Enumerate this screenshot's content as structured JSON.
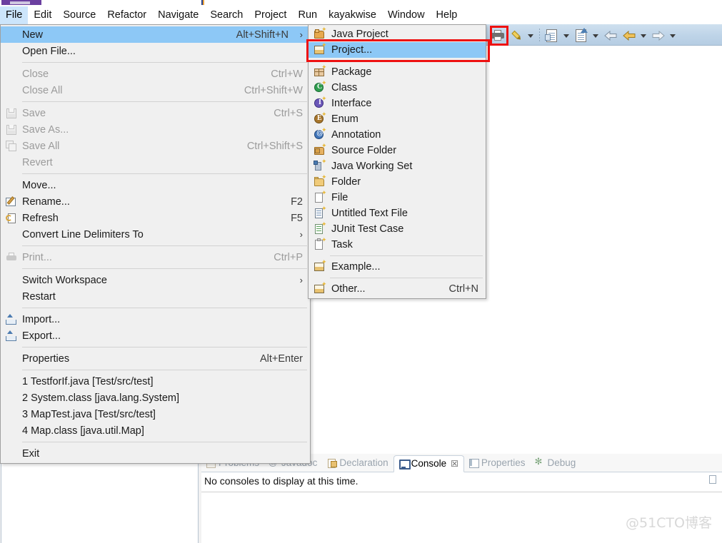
{
  "app": {
    "menubar": [
      {
        "label": "File",
        "active": true
      },
      {
        "label": "Edit",
        "active": false
      },
      {
        "label": "Source",
        "active": false
      },
      {
        "label": "Refactor",
        "active": false
      },
      {
        "label": "Navigate",
        "active": false
      },
      {
        "label": "Search",
        "active": false
      },
      {
        "label": "Project",
        "active": false
      },
      {
        "label": "Run",
        "active": false
      },
      {
        "label": "kayakwise",
        "active": false
      },
      {
        "label": "Window",
        "active": false
      },
      {
        "label": "Help",
        "active": false
      }
    ]
  },
  "toolbar": {
    "items": [
      {
        "name": "print-toolbar-icon"
      },
      {
        "name": "pencil-toolbar-icon"
      },
      {
        "name": "chevron-down-icon"
      },
      {
        "name": "separator"
      },
      {
        "name": "document-export-icon"
      },
      {
        "name": "chevron-down-icon"
      },
      {
        "name": "document-import-icon"
      },
      {
        "name": "chevron-down-icon"
      },
      {
        "name": "back-arrow-icon"
      },
      {
        "name": "back-arrow-yellow-icon"
      },
      {
        "name": "chevron-down-icon"
      },
      {
        "name": "forward-arrow-icon"
      },
      {
        "name": "chevron-down-icon"
      }
    ]
  },
  "file_menu": {
    "groups": [
      {
        "items": [
          {
            "label": "New",
            "accel": "Alt+Shift+N",
            "submenu": true,
            "highlight": true,
            "disabled": false,
            "icon": ""
          },
          {
            "label": "Open File...",
            "accel": "",
            "submenu": false,
            "highlight": false,
            "disabled": false,
            "icon": ""
          }
        ]
      },
      {
        "items": [
          {
            "label": "Close",
            "accel": "Ctrl+W",
            "submenu": false,
            "highlight": false,
            "disabled": true,
            "icon": ""
          },
          {
            "label": "Close All",
            "accel": "Ctrl+Shift+W",
            "submenu": false,
            "highlight": false,
            "disabled": true,
            "icon": ""
          }
        ]
      },
      {
        "items": [
          {
            "label": "Save",
            "accel": "Ctrl+S",
            "submenu": false,
            "highlight": false,
            "disabled": true,
            "icon": "save-icon"
          },
          {
            "label": "Save As...",
            "accel": "",
            "submenu": false,
            "highlight": false,
            "disabled": true,
            "icon": "save-as-icon"
          },
          {
            "label": "Save All",
            "accel": "Ctrl+Shift+S",
            "submenu": false,
            "highlight": false,
            "disabled": true,
            "icon": "save-all-icon"
          },
          {
            "label": "Revert",
            "accel": "",
            "submenu": false,
            "highlight": false,
            "disabled": true,
            "icon": ""
          }
        ]
      },
      {
        "items": [
          {
            "label": "Move...",
            "accel": "",
            "submenu": false,
            "highlight": false,
            "disabled": false,
            "icon": ""
          },
          {
            "label": "Rename...",
            "accel": "F2",
            "submenu": false,
            "highlight": false,
            "disabled": false,
            "icon": "rename-icon"
          },
          {
            "label": "Refresh",
            "accel": "F5",
            "submenu": false,
            "highlight": false,
            "disabled": false,
            "icon": "refresh-icon"
          },
          {
            "label": "Convert Line Delimiters To",
            "accel": "",
            "submenu": true,
            "highlight": false,
            "disabled": false,
            "icon": ""
          }
        ]
      },
      {
        "items": [
          {
            "label": "Print...",
            "accel": "Ctrl+P",
            "submenu": false,
            "highlight": false,
            "disabled": true,
            "icon": "print-icon"
          }
        ]
      },
      {
        "items": [
          {
            "label": "Switch Workspace",
            "accel": "",
            "submenu": true,
            "highlight": false,
            "disabled": false,
            "icon": ""
          },
          {
            "label": "Restart",
            "accel": "",
            "submenu": false,
            "highlight": false,
            "disabled": false,
            "icon": ""
          }
        ]
      },
      {
        "items": [
          {
            "label": "Import...",
            "accel": "",
            "submenu": false,
            "highlight": false,
            "disabled": false,
            "icon": "import-icon"
          },
          {
            "label": "Export...",
            "accel": "",
            "submenu": false,
            "highlight": false,
            "disabled": false,
            "icon": "export-icon"
          }
        ]
      },
      {
        "items": [
          {
            "label": "Properties",
            "accel": "Alt+Enter",
            "submenu": false,
            "highlight": false,
            "disabled": false,
            "icon": ""
          }
        ]
      },
      {
        "items": [
          {
            "label": "1 TestforIf.java  [Test/src/test]",
            "accel": "",
            "submenu": false,
            "highlight": false,
            "disabled": false,
            "icon": ""
          },
          {
            "label": "2 System.class  [java.lang.System]",
            "accel": "",
            "submenu": false,
            "highlight": false,
            "disabled": false,
            "icon": ""
          },
          {
            "label": "3 MapTest.java  [Test/src/test]",
            "accel": "",
            "submenu": false,
            "highlight": false,
            "disabled": false,
            "icon": ""
          },
          {
            "label": "4 Map.class  [java.util.Map]",
            "accel": "",
            "submenu": false,
            "highlight": false,
            "disabled": false,
            "icon": ""
          }
        ]
      },
      {
        "items": [
          {
            "label": "Exit",
            "accel": "",
            "submenu": false,
            "highlight": false,
            "disabled": false,
            "icon": ""
          }
        ]
      }
    ]
  },
  "new_submenu": {
    "groups": [
      {
        "items": [
          {
            "label": "Java Project",
            "accel": "",
            "highlight": false,
            "icon": "java-project-icon"
          },
          {
            "label": "Project...",
            "accel": "",
            "highlight": true,
            "icon": "project-icon"
          }
        ]
      },
      {
        "items": [
          {
            "label": "Package",
            "accel": "",
            "highlight": false,
            "icon": "package-icon"
          },
          {
            "label": "Class",
            "accel": "",
            "highlight": false,
            "icon": "class-icon"
          },
          {
            "label": "Interface",
            "accel": "",
            "highlight": false,
            "icon": "interface-icon"
          },
          {
            "label": "Enum",
            "accel": "",
            "highlight": false,
            "icon": "enum-icon"
          },
          {
            "label": "Annotation",
            "accel": "",
            "highlight": false,
            "icon": "annotation-icon"
          },
          {
            "label": "Source Folder",
            "accel": "",
            "highlight": false,
            "icon": "source-folder-icon"
          },
          {
            "label": "Java Working Set",
            "accel": "",
            "highlight": false,
            "icon": "java-working-set-icon"
          },
          {
            "label": "Folder",
            "accel": "",
            "highlight": false,
            "icon": "folder-icon"
          },
          {
            "label": "File",
            "accel": "",
            "highlight": false,
            "icon": "file-icon"
          },
          {
            "label": "Untitled Text File",
            "accel": "",
            "highlight": false,
            "icon": "untitled-text-file-icon"
          },
          {
            "label": "JUnit Test Case",
            "accel": "",
            "highlight": false,
            "icon": "junit-test-case-icon"
          },
          {
            "label": "Task",
            "accel": "",
            "highlight": false,
            "icon": "task-icon"
          }
        ]
      },
      {
        "items": [
          {
            "label": "Example...",
            "accel": "",
            "highlight": false,
            "icon": "example-icon"
          }
        ]
      },
      {
        "items": [
          {
            "label": "Other...",
            "accel": "Ctrl+N",
            "highlight": false,
            "icon": "other-icon"
          }
        ]
      }
    ]
  },
  "console_panel": {
    "tabs": [
      {
        "label": "Problems",
        "icon": "problems-icon",
        "active": false,
        "closable": false
      },
      {
        "label": "Javadoc",
        "icon": "javadoc-icon",
        "active": false,
        "closable": false
      },
      {
        "label": "Declaration",
        "icon": "declaration-icon",
        "active": false,
        "closable": false
      },
      {
        "label": "Console",
        "icon": "console-icon",
        "active": true,
        "closable": true
      },
      {
        "label": "Properties",
        "icon": "properties-icon",
        "active": false,
        "closable": false
      },
      {
        "label": "Debug",
        "icon": "debug-icon",
        "active": false,
        "closable": false
      }
    ],
    "close_glyph": "☒",
    "message": "No consoles to display at this time."
  },
  "annotations": {
    "watermark": "@51CTO博客",
    "highlight_color": "#ee1111"
  },
  "colors": {
    "menu_highlight": "#8dc8f6",
    "menubar_active": "#cce5fb",
    "menu_bg": "#f0f0f0",
    "toolbar_bg": "#bed4e8"
  }
}
